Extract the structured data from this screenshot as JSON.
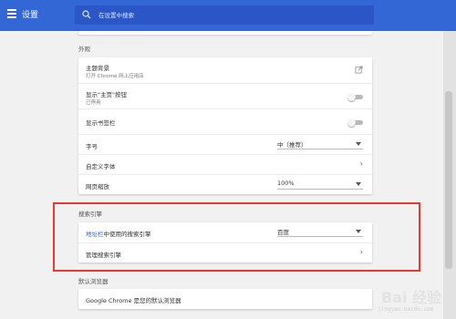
{
  "topbar": {
    "title": "设置",
    "search_placeholder": "在设置中搜索"
  },
  "appearance": {
    "section_label": "外观",
    "theme_label": "主题背景",
    "theme_sub": "打开 Chrome 网上应用店",
    "home_button_label": "显示\"主页\"按钮",
    "home_button_sub": "已停用",
    "bookmarks_bar_label": "显示书签栏",
    "font_size_label": "字号",
    "font_size_value": "中（推荐）",
    "custom_fonts_label": "自定义字体",
    "page_zoom_label": "网页缩放",
    "page_zoom_value": "100%"
  },
  "search_engine": {
    "section_label": "搜索引擎",
    "address_bar_link": "地址栏",
    "address_bar_rest": "中使用的搜索引擎",
    "engine_value": "百度",
    "manage_label": "管理搜索引擎"
  },
  "default_browser": {
    "section_label": "默认浏览器",
    "status_text": "Google Chrome 是您的默认浏览器"
  },
  "watermark": {
    "text": "Bai 经验",
    "sub": "jingyan.baidu.com"
  },
  "colors": {
    "topbar": "#3367d6",
    "highlight": "#e53935",
    "link": "#3367d6"
  }
}
